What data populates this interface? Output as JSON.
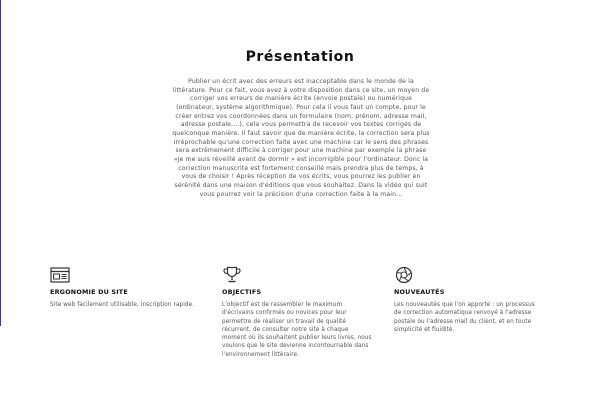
{
  "presentation": {
    "title": "Présentation",
    "text": "Publier un écrit avec des erreurs est inacceptable dans le monde de la littérature. Pour ce fait, vous avez à votre disposition dans ce site, un moyen de corriger vos erreurs de manière écrite (envoie postale) ou numérique (ordinateur, système algorithmique). Pour cela il vous faut un compte, pour le créer entrez vos coordonnées dans un formulaire (nom, prénom, adresse mail, adresse postale,...), cela vous permettra de recevoir vos textes corrigés de quelconque manière. Il faut savoir que de manière écrite, la correction sera plus irréprochable qu'une correction faite avec une machine car le sens des phrases sera extrêmement difficile à corriger pour une machine par exemple la phrase «Je me suis réveillé avant de dormir » est incorrigible pour l'ordinateur. Donc la correction manuscrite est fortement conseillé mais prendra plus de temps, à vous de choisir ! Après réception de vos écrits, vous pourrez les publier en sérénité dans une maison d'éditions que vous souhaitez. Dans la vidéo qui suit vous pourrez voir la précision d'une correction faite à la main..."
  },
  "features": [
    {
      "icon": "browser-window-icon",
      "title": "ERGONOMIE DU SITE",
      "text": "Site web facilement utilisable, inscription rapide."
    },
    {
      "icon": "trophy-icon",
      "title": "OBJECTIFS",
      "text": "L'objectif est de rassembler le maximum d'écrivains confirmés ou novices pour leur permettre de réaliser un travail de qualité récurrent, de consulter notre site à chaque moment où ils souhaitent publier leurs livres, nous voulons que le site devienne incontournable dans l'environnement littéraire."
    },
    {
      "icon": "aperture-icon",
      "title": "NOUVEAUTÉS",
      "text": "Les nouveautés que l'on apporte : un processus de correction automatique renvoyé à l'adresse postale ou l'adresse mail du client, et en toute simplicité et fluidité."
    }
  ]
}
